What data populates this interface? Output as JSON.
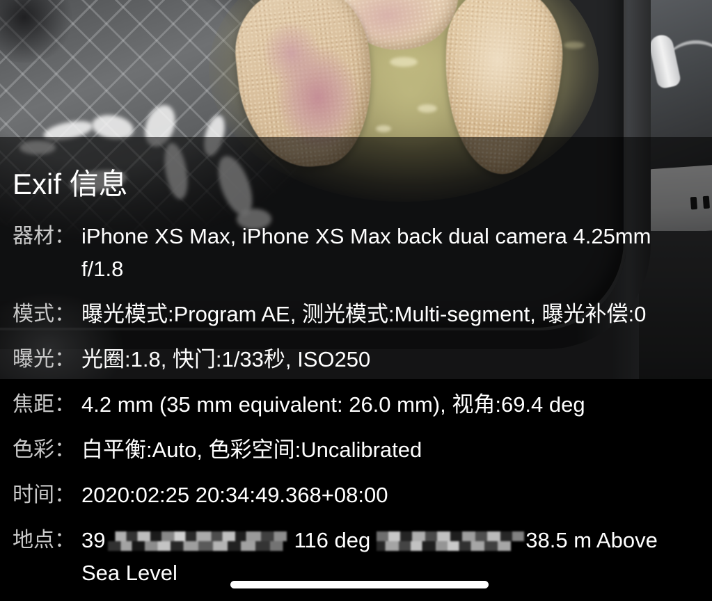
{
  "colors": {
    "background": "#000000",
    "text": "#ffffff",
    "label_text": "#c8c8c8",
    "overlay": "#0000008c",
    "home_indicator": "#ffffff"
  },
  "exif": {
    "title": "Exif 信息",
    "rows": [
      {
        "label": "器材：",
        "value": "iPhone XS Max, iPhone XS Max back dual camera 4.25mm f/1.8"
      },
      {
        "label": "模式：",
        "value": "曝光模式:Program AE, 测光模式:Multi-segment, 曝光补偿:0"
      },
      {
        "label": "曝光：",
        "value": "光圈:1.8, 快门:1/33秒, ISO250"
      },
      {
        "label": "焦距：",
        "value": "4.2 mm (35 mm equivalent: 26.0 mm), 视角:69.4 deg"
      },
      {
        "label": "色彩：",
        "value": "白平衡:Auto, 色彩空间:Uncalibrated"
      },
      {
        "label": "时间：",
        "value": "2020:02:25 20:34:49.368+08:00"
      },
      {
        "label": "地点：",
        "parts": [
          "39",
          "116 deg",
          "38.5 m Above Sea Level"
        ]
      }
    ]
  }
}
